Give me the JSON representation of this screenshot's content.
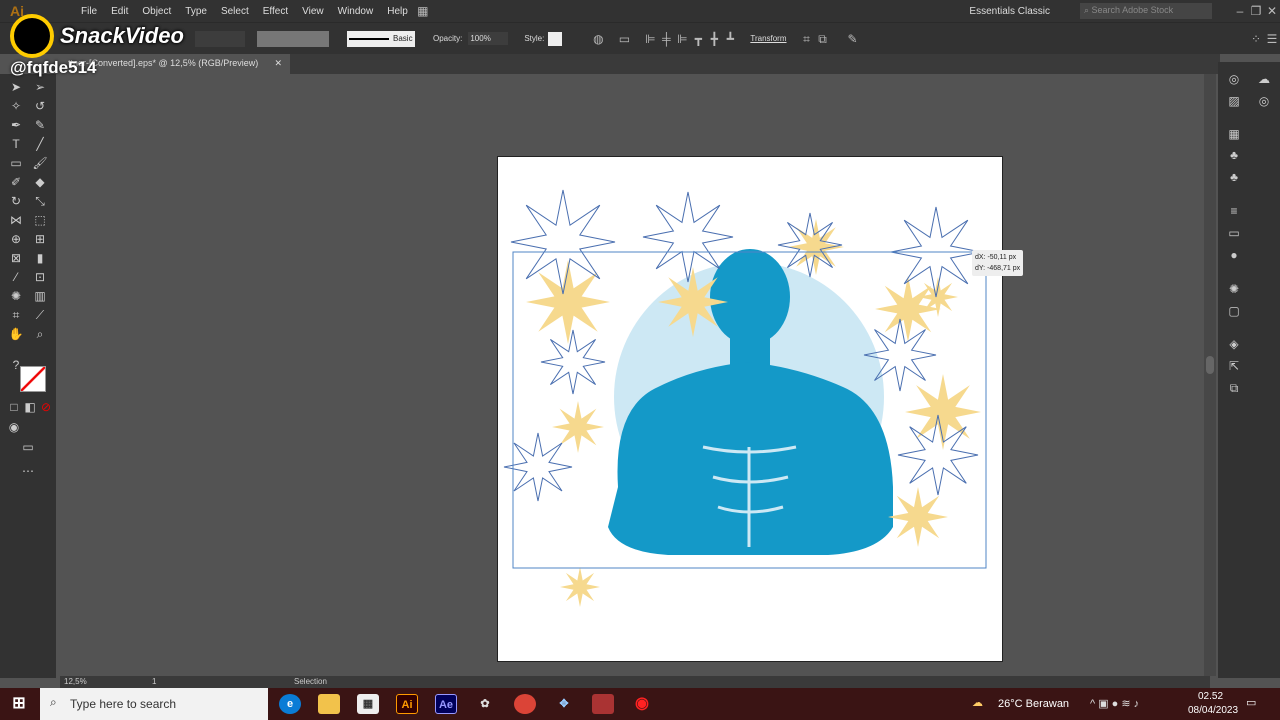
{
  "app": {
    "logo": "Ai",
    "menu": [
      "File",
      "Edit",
      "Object",
      "Type",
      "Select",
      "Effect",
      "View",
      "Window",
      "Help"
    ],
    "workspace": "Essentials Classic",
    "stock_search_placeholder": "Search Adobe Stock"
  },
  "control": {
    "stroke_style": "Basic",
    "opacity_label": "Opacity:",
    "opacity_value": "100%",
    "style_label": "Style:",
    "transform_label": "Transform"
  },
  "document": {
    "tab_title": "ttner-[Converted].eps* @ 12,5% (RGB/Preview)"
  },
  "tooltip": {
    "dx": "dX: -50,11 px",
    "dy": "dY: -468,71 px"
  },
  "statusbar": {
    "zoom": "12,5%",
    "artboard": "1",
    "tool": "Selection"
  },
  "watermark": {
    "brand": "SnackVideo",
    "handle": "@fqfde514"
  },
  "taskbar": {
    "search_placeholder": "Type here to search",
    "weather": "26°C  Berawan",
    "time": "02.52",
    "date": "08/04/2023"
  },
  "colors": {
    "figure": "#1499c8",
    "halo": "#cde8f4",
    "star_fill": "#f6d98e",
    "star_line": "#4a6fb0",
    "accent": "#ff9a00"
  }
}
